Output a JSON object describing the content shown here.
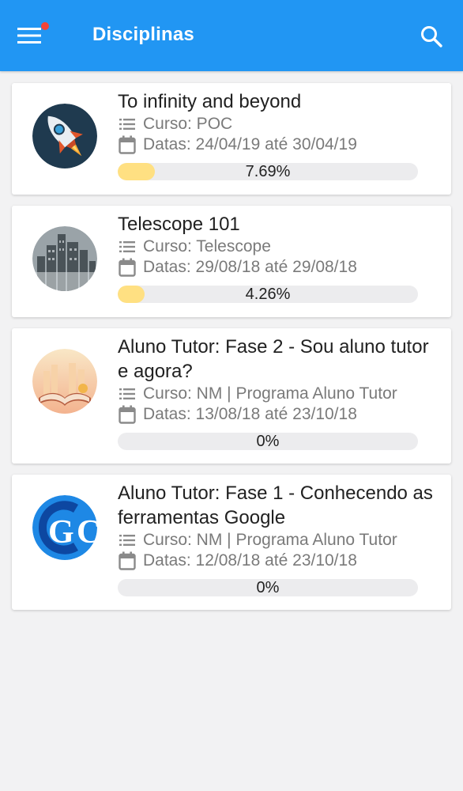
{
  "appbar": {
    "title": "Disciplinas",
    "colors": {
      "primary": "#2196f3",
      "badge": "#f44336"
    },
    "menu_icon": "hamburger-menu-icon",
    "search_icon": "search-icon"
  },
  "courses": [
    {
      "title": "To infinity and beyond",
      "course_label": "Curso: POC",
      "dates_label": "Datas: 24/04/19 até 30/04/19",
      "progress_text": "7.69%",
      "progress_value": 7.69,
      "thumbnail": "rocket-thumbnail"
    },
    {
      "title": "Telescope 101",
      "course_label": "Curso: Telescope",
      "dates_label": "Datas: 29/08/18 até 29/08/18",
      "progress_text": "4.26%",
      "progress_value": 4.26,
      "thumbnail": "city-skyline-thumbnail"
    },
    {
      "title": "Aluno Tutor: Fase 2 - Sou aluno tutor e agora?",
      "course_label": "Curso: NM | Programa Aluno Tutor",
      "dates_label": "Datas: 13/08/18 até 23/10/18",
      "progress_text": "0%",
      "progress_value": 0,
      "thumbnail": "open-book-thumbnail"
    },
    {
      "title": "Aluno Tutor: Fase 1 - Conhecendo as ferramentas Google",
      "course_label": "Curso: NM | Programa Aluno Tutor",
      "dates_label": "Datas: 12/08/18 até 23/10/18",
      "progress_text": "0%",
      "progress_value": 0,
      "thumbnail": "google-logo-thumbnail"
    }
  ]
}
